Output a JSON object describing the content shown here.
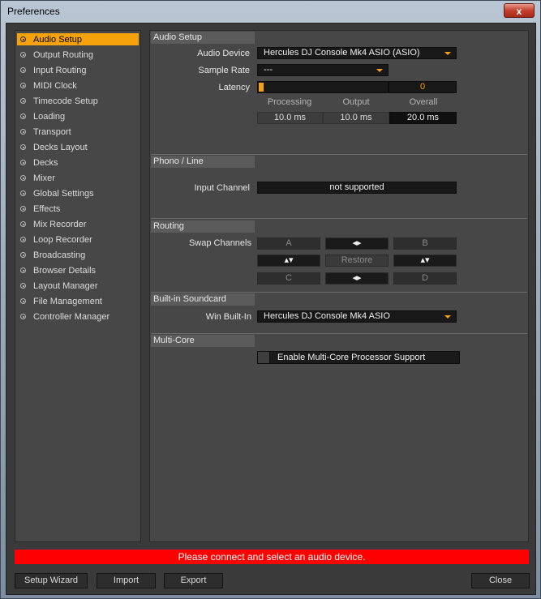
{
  "window": {
    "title": "Preferences",
    "close_glyph": "x"
  },
  "sidebar": {
    "items": [
      {
        "label": "Audio Setup",
        "active": true
      },
      {
        "label": "Output Routing"
      },
      {
        "label": "Input Routing"
      },
      {
        "label": "MIDI Clock"
      },
      {
        "label": "Timecode Setup"
      },
      {
        "label": "Loading"
      },
      {
        "label": "Transport"
      },
      {
        "label": "Decks Layout"
      },
      {
        "label": "Decks"
      },
      {
        "label": "Mixer"
      },
      {
        "label": "Global Settings"
      },
      {
        "label": "Effects"
      },
      {
        "label": "Mix Recorder"
      },
      {
        "label": "Loop Recorder"
      },
      {
        "label": "Broadcasting"
      },
      {
        "label": "Browser Details"
      },
      {
        "label": "Layout Manager"
      },
      {
        "label": "File Management"
      },
      {
        "label": "Controller Manager"
      }
    ]
  },
  "audio_setup": {
    "header": "Audio Setup",
    "audio_device_label": "Audio Device",
    "audio_device_value": "Hercules DJ Console Mk4 ASIO (ASIO)",
    "sample_rate_label": "Sample Rate",
    "sample_rate_value": "---",
    "latency_label": "Latency",
    "latency_value": "0",
    "latency_fraction": 0,
    "processing_label": "Processing",
    "output_label": "Output",
    "overall_label": "Overall",
    "processing_value": "10.0 ms",
    "output_value": "10.0 ms",
    "overall_value": "20.0 ms"
  },
  "phono": {
    "header": "Phono / Line",
    "input_channel_label": "Input Channel",
    "input_channel_value": "not supported"
  },
  "routing": {
    "header": "Routing",
    "swap_label": "Swap Channels",
    "a": "A",
    "b": "B",
    "c": "C",
    "d": "D",
    "swap_glyph": "◂▸",
    "updown_glyph": "▴▾",
    "restore": "Restore"
  },
  "soundcard": {
    "header": "Built-in Soundcard",
    "win_label": "Win Built-In",
    "win_value": "Hercules DJ Console Mk4 ASIO"
  },
  "multicore": {
    "header": "Multi-Core",
    "enable_label": "Enable Multi-Core Processor Support",
    "checked": false
  },
  "status": {
    "message": "Please connect and select an audio device."
  },
  "footer": {
    "setup_wizard": "Setup Wizard",
    "import": "Import",
    "export": "Export",
    "close": "Close"
  },
  "colors": {
    "accent": "#f5a20c",
    "error": "#ff0000"
  }
}
